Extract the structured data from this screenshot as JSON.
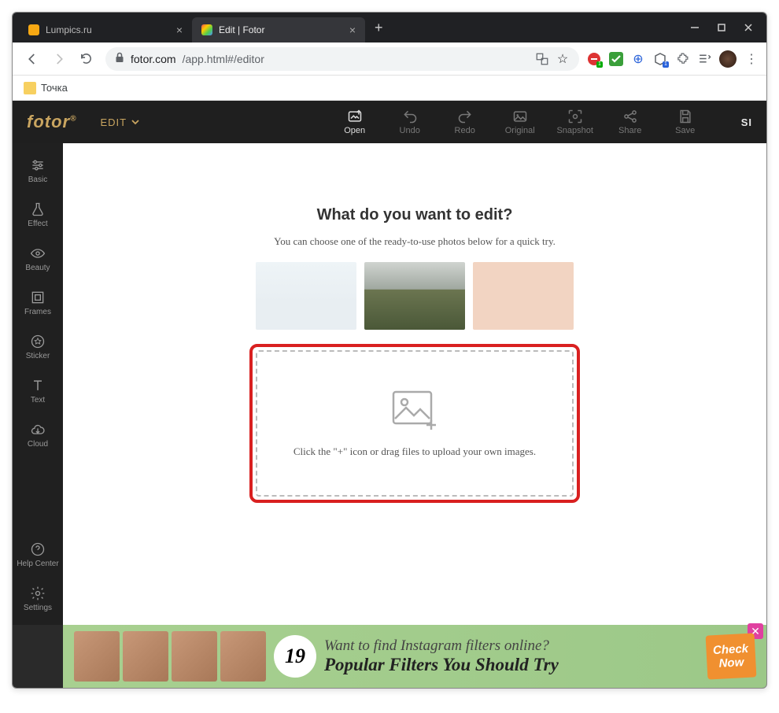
{
  "browser": {
    "tabs": [
      {
        "title": "Lumpics.ru",
        "active": false
      },
      {
        "title": "Edit | Fotor",
        "active": true
      }
    ],
    "url_domain": "fotor.com",
    "url_path": "/app.html#/editor",
    "bookmark": "Точка"
  },
  "app": {
    "logo": "fotor",
    "mode": "EDIT",
    "sign": "SI",
    "toolbar": {
      "open": "Open",
      "undo": "Undo",
      "redo": "Redo",
      "original": "Original",
      "snapshot": "Snapshot",
      "share": "Share",
      "save": "Save"
    },
    "sidebar": {
      "basic": "Basic",
      "effect": "Effect",
      "beauty": "Beauty",
      "frames": "Frames",
      "sticker": "Sticker",
      "text": "Text",
      "cloud": "Cloud",
      "help": "Help Center",
      "settings": "Settings"
    },
    "main": {
      "title": "What do you want to edit?",
      "subtitle": "You can choose one of the ready-to-use photos below for a quick try.",
      "dropzone_text": "Click the \"+\" icon or drag files to upload your own images."
    },
    "banner": {
      "number": "19",
      "line1": "Want to find Instagram filters online?",
      "line2": "Popular Filters You Should Try",
      "cta1": "Check",
      "cta2": "Now"
    }
  }
}
